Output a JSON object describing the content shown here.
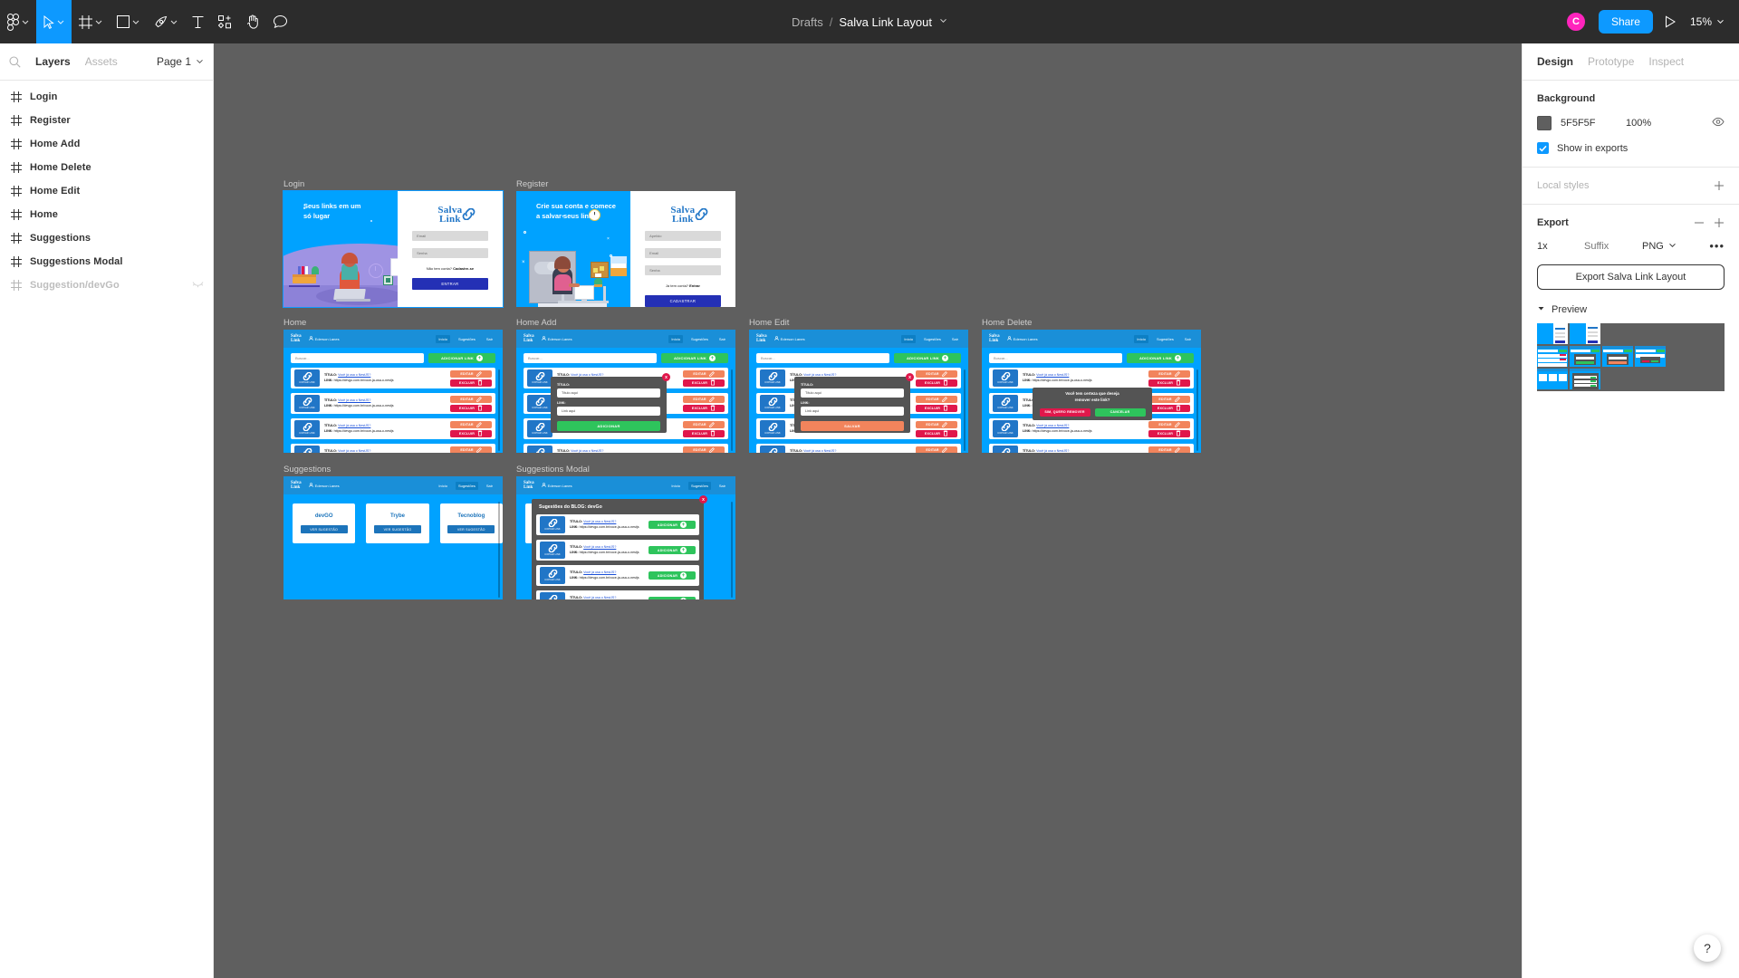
{
  "app": {
    "name": "Figma"
  },
  "topbar": {
    "tools": [
      {
        "name": "figma-menu-icon",
        "label": "Main menu"
      },
      {
        "name": "move-tool-icon",
        "label": "Move"
      },
      {
        "name": "frame-tool-icon",
        "label": "Frame"
      },
      {
        "name": "shape-tool-icon",
        "label": "Rectangle"
      },
      {
        "name": "pen-tool-icon",
        "label": "Pen"
      },
      {
        "name": "text-tool-icon",
        "label": "Text"
      },
      {
        "name": "resources-icon",
        "label": "Resources"
      },
      {
        "name": "hand-tool-icon",
        "label": "Hand"
      },
      {
        "name": "comment-tool-icon",
        "label": "Comment"
      }
    ],
    "breadcrumb": {
      "parent": "Drafts",
      "separator": "/",
      "file": "Salva Link Layout"
    },
    "avatar_initial": "C",
    "share_label": "Share",
    "zoom_level": "15%"
  },
  "left_panel": {
    "tabs": {
      "layers": "Layers",
      "assets": "Assets"
    },
    "page_selector": "Page 1",
    "layers": [
      {
        "label": "Login",
        "hidden": false
      },
      {
        "label": "Register",
        "hidden": false
      },
      {
        "label": "Home Add",
        "hidden": false
      },
      {
        "label": "Home Delete",
        "hidden": false
      },
      {
        "label": "Home Edit",
        "hidden": false
      },
      {
        "label": "Home",
        "hidden": false
      },
      {
        "label": "Suggestions",
        "hidden": false
      },
      {
        "label": "Suggestions Modal",
        "hidden": false
      },
      {
        "label": "Suggestion/devGo",
        "hidden": true
      }
    ]
  },
  "right_panel": {
    "tabs": [
      {
        "label": "Design",
        "active": true
      },
      {
        "label": "Prototype",
        "active": false
      },
      {
        "label": "Inspect",
        "active": false
      }
    ],
    "background": {
      "title": "Background",
      "hex": "5F5F5F",
      "opacity": "100%",
      "show_in_exports": "Show in exports"
    },
    "local_styles": {
      "title": "Local styles"
    },
    "export": {
      "title": "Export",
      "scale": "1x",
      "suffix_placeholder": "Suffix",
      "format": "PNG",
      "button_label": "Export Salva Link Layout",
      "preview_label": "Preview"
    }
  },
  "canvas": {
    "background_color": "#5F5F5F",
    "frames": [
      {
        "name": "Login"
      },
      {
        "name": "Register"
      },
      {
        "name": "Home"
      },
      {
        "name": "Home Add"
      },
      {
        "name": "Home Edit"
      },
      {
        "name": "Home Delete"
      },
      {
        "name": "Suggestions"
      },
      {
        "name": "Suggestions Modal"
      }
    ]
  },
  "design": {
    "brand": {
      "logo_line1": "Salva",
      "logo_line2": "Link"
    },
    "login": {
      "headline": "Seus links em um\nsó lugar",
      "email_placeholder": "Email",
      "password_placeholder": "Senha",
      "note": "Não tem conta?",
      "note_link": "Cadastre-se",
      "submit": "ENTRAR"
    },
    "register": {
      "headline": "Crie sua conta e comece\na salvar seus links",
      "nick_placeholder": "Apelido",
      "email_placeholder": "Email",
      "password_placeholder": "Senha",
      "note": "Já tem conta?",
      "note_link": "Entrar",
      "submit": "CADASTRAR"
    },
    "nav": {
      "user": "Ederson Lanes",
      "links": [
        {
          "label": "Início",
          "active": true
        },
        {
          "label": "Sugestões",
          "active": false
        },
        {
          "label": "Sair",
          "active": false
        }
      ],
      "links_suggestions_active": [
        {
          "label": "Início",
          "active": false
        },
        {
          "label": "Sugestões",
          "active": true
        },
        {
          "label": "Sair",
          "active": false
        }
      ]
    },
    "home": {
      "search_placeholder": "Buscar...",
      "add_link_label": "ADICIONAR LINK",
      "copy_tile_label": "COPIAR LINK",
      "card_title_label": "TÍTULO:",
      "card_title_value": "Você já usa o NestJS?",
      "card_link_label": "LINK:",
      "card_link_value": "https://devgo.com.br/voce-ja-usa-o-nestjs",
      "edit_label": "EDITAR",
      "delete_label": "EXCLUIR"
    },
    "add_modal": {
      "title_label": "TÍTULO:",
      "title_value": "Título aqui",
      "link_label": "LINK:",
      "link_value": "Link aqui",
      "submit": "ADICIONAR",
      "close": "x"
    },
    "edit_modal": {
      "title_label": "TÍTULO:",
      "title_value": "Título aqui",
      "link_label": "LINK:",
      "link_value": "Link aqui",
      "submit": "SALVAR",
      "close": "x"
    },
    "delete_modal": {
      "message": "Você tem certeza que deseja\nremover este link?",
      "confirm": "SIM, QUERO REMOVER",
      "cancel": "CANCELAR"
    },
    "suggestions": {
      "cards": [
        {
          "name": "devGO",
          "button": "VER SUGESTÃO"
        },
        {
          "name": "Trybe",
          "button": "VER SUGESTÃO"
        },
        {
          "name": "Tecnoblog",
          "button": "VER SUGESTÃO"
        }
      ]
    },
    "suggestions_modal": {
      "title": "Sugestões do BLOG: devGo",
      "add_label": "ADICIONAR",
      "close": "x"
    }
  },
  "help": {
    "label": "?"
  }
}
